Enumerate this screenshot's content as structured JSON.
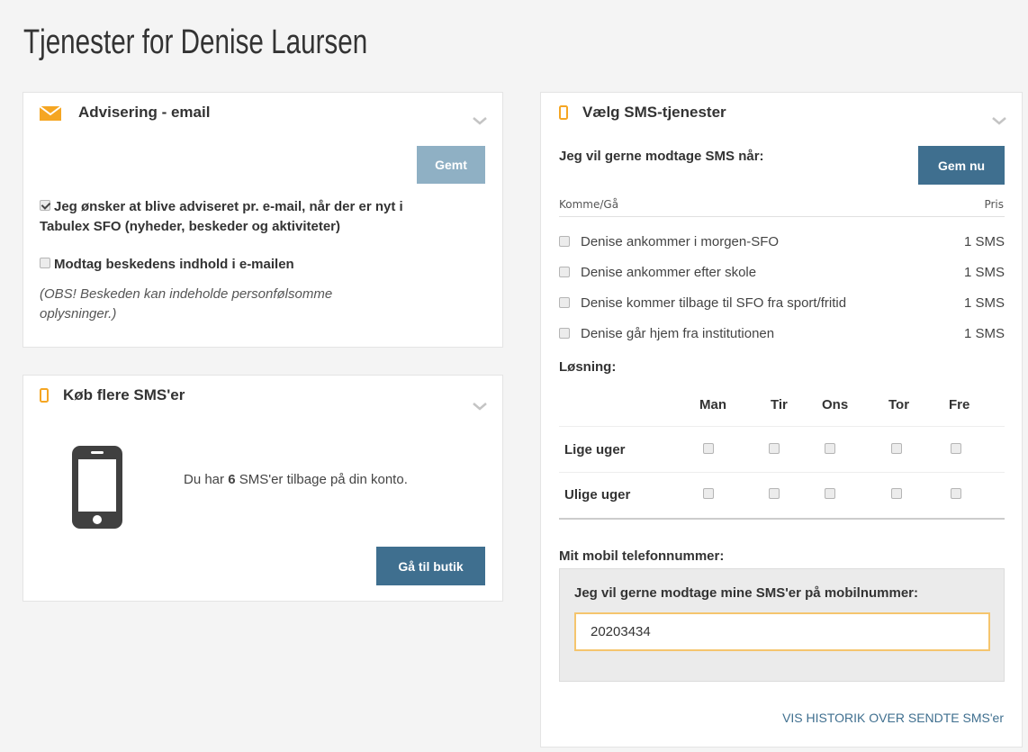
{
  "page": {
    "title": "Tjenester for Denise Laursen"
  },
  "email_panel": {
    "title": "Advisering - email",
    "save_label": "Gemt",
    "option1_line1": "Jeg ønsker at blive adviseret pr. e-mail, når der er nyt i",
    "option1_line2": "Tabulex SFO (nyheder, beskeder og aktiviteter)",
    "option1_checked": true,
    "option2": "Modtag beskedens indhold i e-mailen",
    "option2_checked": false,
    "note_line1": "(OBS! Beskeden kan indeholde personfølsomme",
    "note_line2": "oplysninger.)"
  },
  "buy_panel": {
    "title": "Køb flere SMS'er",
    "balance_prefix": "Du har ",
    "balance_count": "6",
    "balance_suffix": " SMS'er tilbage på din konto.",
    "shop_label": "Gå til butik"
  },
  "sms_panel": {
    "title": "Vælg SMS-tjenester",
    "intro": "Jeg vil gerne modtage SMS når:",
    "save_label": "Gem nu",
    "col_left": "Komme/Gå",
    "col_right": "Pris",
    "items": [
      {
        "label": "Denise ankommer i morgen-SFO",
        "price": "1 SMS"
      },
      {
        "label": "Denise ankommer efter skole",
        "price": "1 SMS"
      },
      {
        "label": "Denise kommer tilbage til SFO fra sport/fritid",
        "price": "1 SMS"
      },
      {
        "label": "Denise går hjem fra institutionen",
        "price": "1 SMS"
      }
    ],
    "solution_label": "Løsning:",
    "days": [
      "Man",
      "Tir",
      "Ons",
      "Tor",
      "Fre"
    ],
    "weeks": [
      "Lige uger",
      "Ulige uger"
    ],
    "phone_heading": "Mit mobil telefonnummer:",
    "phone_prompt": "Jeg vil gerne modtage mine SMS'er på mobilnummer:",
    "phone_value": "20203434",
    "history_link": "VIS HISTORIK OVER SENDTE SMS'er"
  },
  "colors": {
    "accent": "#f5a623",
    "button": "#3f6f8f",
    "button_disabled": "#8fb0c4",
    "link": "#3f6f8f"
  }
}
